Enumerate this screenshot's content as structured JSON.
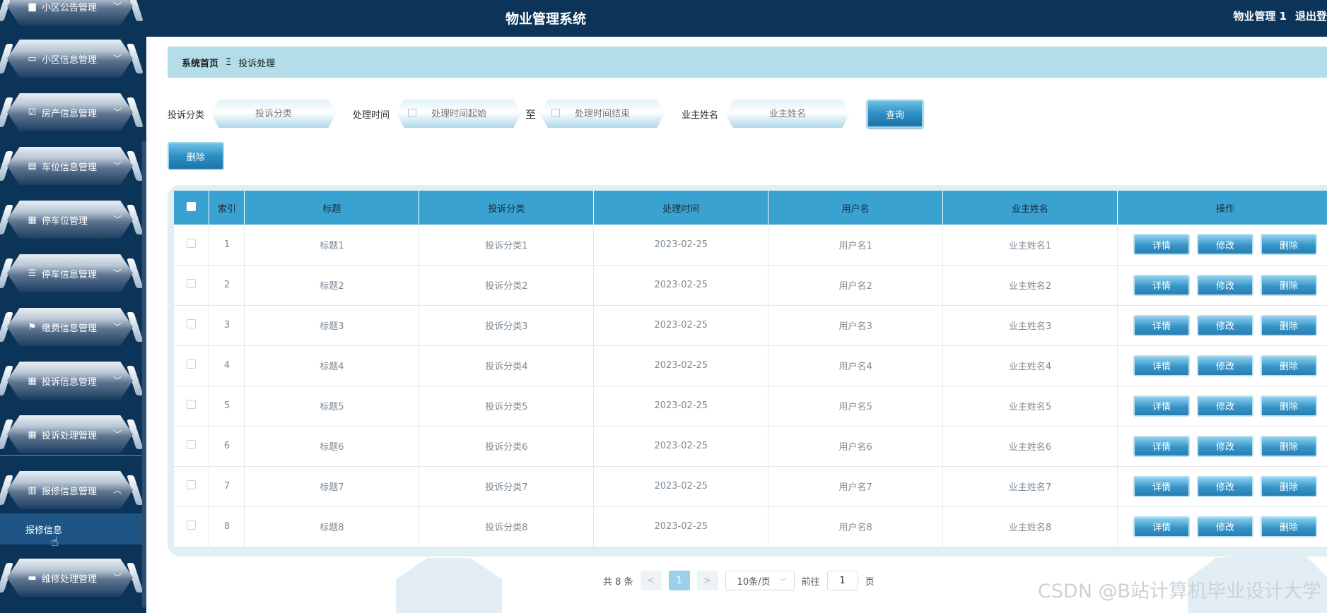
{
  "app": {
    "title": "物业管理系统",
    "user": "物业管理 1",
    "logout": "退出登"
  },
  "sidebar": {
    "items": [
      {
        "label": "小区公告管理",
        "icon": "notice-icon"
      },
      {
        "label": "小区信息管理",
        "icon": "monitor-icon"
      },
      {
        "label": "房产信息管理",
        "icon": "clipboard-check-icon"
      },
      {
        "label": "车位信息管理",
        "icon": "clipboard-icon"
      },
      {
        "label": "停车位管理",
        "icon": "grid-icon"
      },
      {
        "label": "停车信息管理",
        "icon": "list-icon"
      },
      {
        "label": "缴费信息管理",
        "icon": "flag-icon"
      },
      {
        "label": "投诉信息管理",
        "icon": "grid-icon"
      },
      {
        "label": "投诉处理管理",
        "icon": "grid-icon"
      },
      {
        "label": "报修信息管理",
        "icon": "book-icon"
      },
      {
        "label": "维修处理管理",
        "icon": "chat-icon"
      }
    ],
    "submenu_item": "报修信息"
  },
  "breadcrumb": {
    "home": "系统首页",
    "separator": "Ξ",
    "current": "投诉处理"
  },
  "search": {
    "category_label": "投诉分类",
    "category_placeholder": "投诉分类",
    "time_label": "处理时间",
    "time_start_placeholder": "处理时间起始",
    "time_to": "至",
    "time_end_placeholder": "处理时间结束",
    "owner_label": "业主姓名",
    "owner_placeholder": "业主姓名",
    "query_button": "查询",
    "delete_button": "删除"
  },
  "table": {
    "headers": {
      "index": "索引",
      "title": "标题",
      "category": "投诉分类",
      "time": "处理时间",
      "username": "用户名",
      "owner": "业主姓名",
      "ops": "操作"
    },
    "actions": {
      "detail": "详情",
      "edit": "修改",
      "delete": "删除"
    },
    "rows": [
      {
        "index": "1",
        "title": "标题1",
        "category": "投诉分类1",
        "time": "2023-02-25",
        "username": "用户名1",
        "owner": "业主姓名1"
      },
      {
        "index": "2",
        "title": "标题2",
        "category": "投诉分类2",
        "time": "2023-02-25",
        "username": "用户名2",
        "owner": "业主姓名2"
      },
      {
        "index": "3",
        "title": "标题3",
        "category": "投诉分类3",
        "time": "2023-02-25",
        "username": "用户名3",
        "owner": "业主姓名3"
      },
      {
        "index": "4",
        "title": "标题4",
        "category": "投诉分类4",
        "time": "2023-02-25",
        "username": "用户名4",
        "owner": "业主姓名4"
      },
      {
        "index": "5",
        "title": "标题5",
        "category": "投诉分类5",
        "time": "2023-02-25",
        "username": "用户名5",
        "owner": "业主姓名5"
      },
      {
        "index": "6",
        "title": "标题6",
        "category": "投诉分类6",
        "time": "2023-02-25",
        "username": "用户名6",
        "owner": "业主姓名6"
      },
      {
        "index": "7",
        "title": "标题7",
        "category": "投诉分类7",
        "time": "2023-02-25",
        "username": "用户名7",
        "owner": "业主姓名7"
      },
      {
        "index": "8",
        "title": "标题8",
        "category": "投诉分类8",
        "time": "2023-02-25",
        "username": "用户名8",
        "owner": "业主姓名8"
      }
    ]
  },
  "pagination": {
    "total": "共 8 条",
    "prev": "<",
    "page": "1",
    "next": ">",
    "page_size": "10条/页",
    "goto_prefix": "前往",
    "goto_value": "1",
    "goto_suffix": "页"
  },
  "watermark": "CSDN @B站计算机毕业设计大学"
}
